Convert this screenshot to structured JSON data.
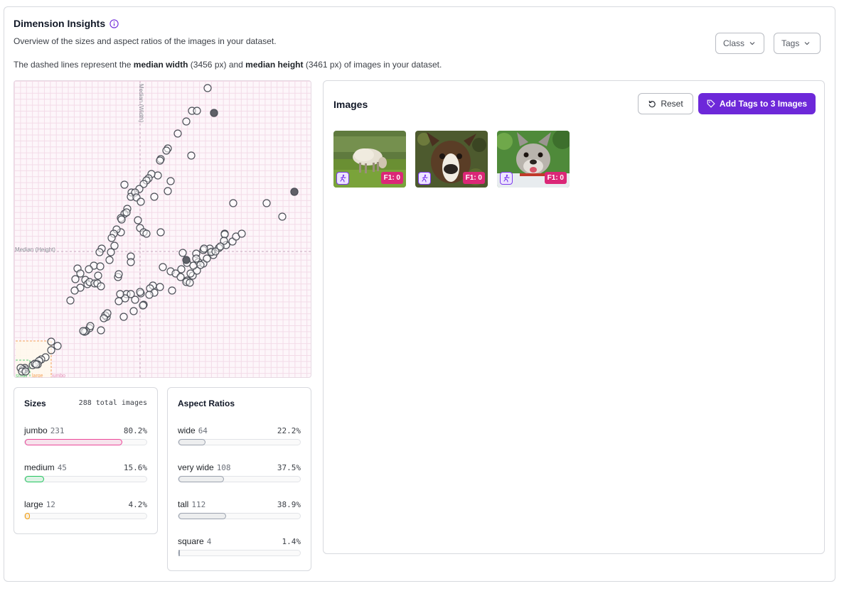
{
  "header": {
    "title": "Dimension Insights",
    "subtitle": "Overview of the sizes and aspect ratios of the images in your dataset.",
    "desc_prefix": "The dashed lines represent the ",
    "median_width_label": "median width",
    "median_width_value": " (3456 px) and ",
    "median_height_label": "median height",
    "median_height_value": " (3461 px) of images in your dataset."
  },
  "filters": {
    "class_label": "Class",
    "tags_label": "Tags"
  },
  "plot": {
    "median_width_label": "Median (Width)",
    "median_height_label": "Median (Height)",
    "zone_labels": [
      "small",
      "large",
      "jumbo"
    ],
    "colors": {
      "point_stroke": "#4b4f57",
      "point_selected": "#5f6168",
      "median_line": "#c9a8bf",
      "medium_zone": "#55cc77",
      "large_zone": "#f4a25a",
      "jumbo_label": "#e58fb7"
    }
  },
  "sizes": {
    "title": "Sizes",
    "total": "288 total images",
    "rows": [
      {
        "label": "jumbo",
        "count": "231",
        "percent": "80.2%",
        "fraction": 0.802,
        "color": "#ec4899"
      },
      {
        "label": "medium",
        "count": "45",
        "percent": "15.6%",
        "fraction": 0.156,
        "color": "#22c55e"
      },
      {
        "label": "large",
        "count": "12",
        "percent": "4.2%",
        "fraction": 0.042,
        "color": "#f59e0b"
      }
    ]
  },
  "aspect_ratios": {
    "title": "Aspect Ratios",
    "rows": [
      {
        "label": "wide",
        "count": "64",
        "percent": "22.2%",
        "fraction": 0.222,
        "color": "#9ca3af"
      },
      {
        "label": "very wide",
        "count": "108",
        "percent": "37.5%",
        "fraction": 0.375,
        "color": "#9ca3af"
      },
      {
        "label": "tall",
        "count": "112",
        "percent": "38.9%",
        "fraction": 0.389,
        "color": "#9ca3af"
      },
      {
        "label": "square",
        "count": "4",
        "percent": "1.4%",
        "fraction": 0.014,
        "color": "#9ca3af"
      }
    ]
  },
  "images_panel": {
    "title": "Images",
    "reset_label": "Reset",
    "add_tags_label": "Add Tags to 3 Images",
    "images": [
      {
        "subject": "sheep",
        "score": "F1: 0"
      },
      {
        "subject": "dog",
        "score": "F1: 0"
      },
      {
        "subject": "dog",
        "score": "F1: 0"
      }
    ]
  },
  "accent_color": "#6d28d9"
}
